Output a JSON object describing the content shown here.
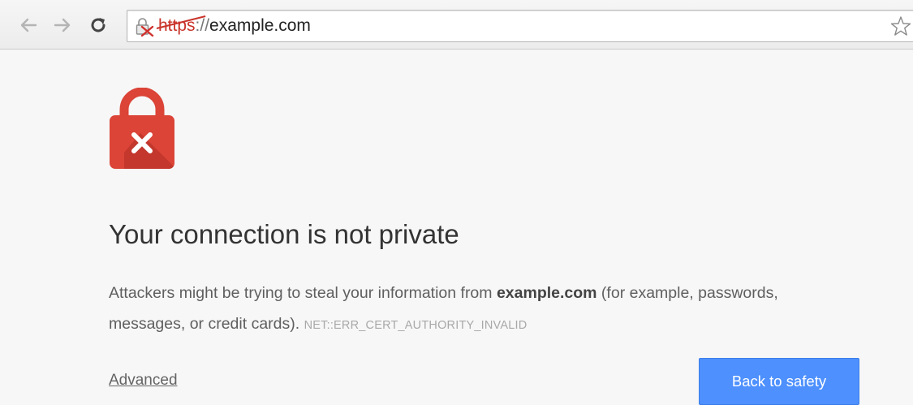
{
  "toolbar": {
    "url_scheme": "https",
    "url_separator": "://",
    "url_host": "example.com",
    "back_icon": "back-arrow-icon",
    "forward_icon": "forward-arrow-icon",
    "reload_icon": "reload-icon",
    "bookmark_icon": "star-icon"
  },
  "interstitial": {
    "icon": "lock-error-icon",
    "title": "Your connection is not private",
    "body_before": "Attackers might be trying to steal your information from ",
    "body_host": "example.com",
    "body_after": " (for example, passwords, messages, or credit cards). ",
    "error_code": "NET::ERR_CERT_AUTHORITY_INVALID",
    "advanced_label": "Advanced",
    "back_button_label": "Back to safety"
  },
  "colors": {
    "error_red": "#db4437",
    "button_blue": "#4d90fe",
    "page_background": "#f7f7f7"
  }
}
